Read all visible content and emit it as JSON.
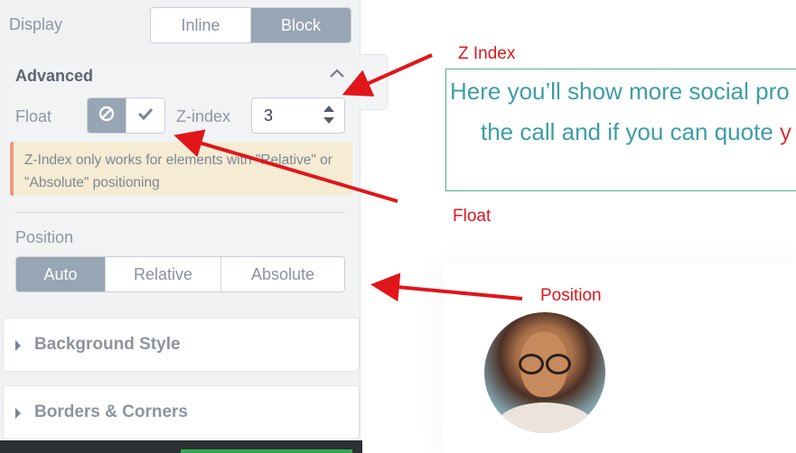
{
  "sidebar": {
    "display": {
      "label": "Display",
      "options": [
        "Inline",
        "Block"
      ],
      "selected": "Block"
    },
    "advanced": {
      "title": "Advanced",
      "float_label": "Float",
      "float_options": [
        "none-icon",
        "check-icon"
      ],
      "zindex_label": "Z-index",
      "zindex_value": "3",
      "notice": "Z-Index only works for elements with \"Relative\" or \"Absolute\" positioning",
      "position_label": "Position",
      "position_options": [
        "Auto",
        "Relative",
        "Absolute"
      ],
      "position_selected": "Auto"
    },
    "sections": [
      "Background Style",
      "Borders & Corners"
    ]
  },
  "canvas": {
    "quote_line1": "Here you’ll show more social pro",
    "quote_line2_start": "the call and if you can quote ",
    "quote_line2_red": "y"
  },
  "annotations": {
    "z_index": "Z Index",
    "float": "Float",
    "position": "Position"
  },
  "colors": {
    "annotation": "#e0161b",
    "active_segment": "#97a5b4",
    "quote_text": "#3d9da6",
    "quote_border": "#4fb08d",
    "notice_bg": "#f6ecd4",
    "notice_accent": "#ef9a7c"
  }
}
